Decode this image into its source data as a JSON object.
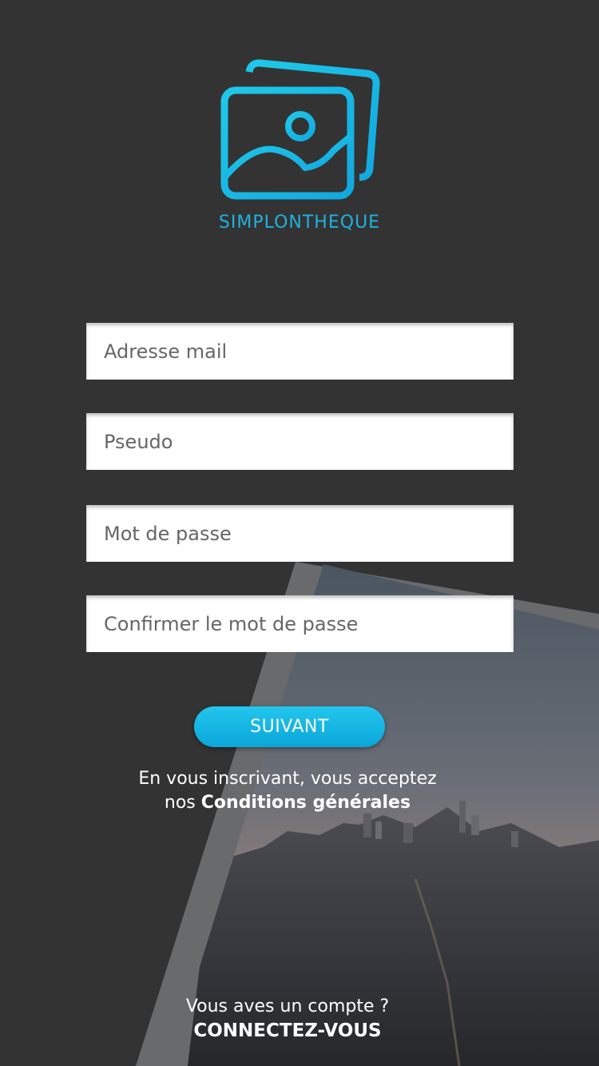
{
  "app": {
    "logo_text": "SIMPLONTHEQUE"
  },
  "form": {
    "email_placeholder": "Adresse mail",
    "pseudo_placeholder": "Pseudo",
    "password_placeholder": "Mot de passe",
    "confirm_placeholder": "Confirmer le mot de passe",
    "next_label": "SUIVANT"
  },
  "terms": {
    "line1": "En vous inscrivant, vous acceptez",
    "prefix": "nos ",
    "link_label": "Conditions générales"
  },
  "login": {
    "prompt": "Vous aves un compte ?",
    "link_label": "CONNECTEZ-VOUS"
  },
  "colors": {
    "background": "#333333",
    "accent": "#1fb2e0",
    "field_bg": "#ffffff"
  },
  "icons": {
    "logo": "photos-stack-icon"
  }
}
